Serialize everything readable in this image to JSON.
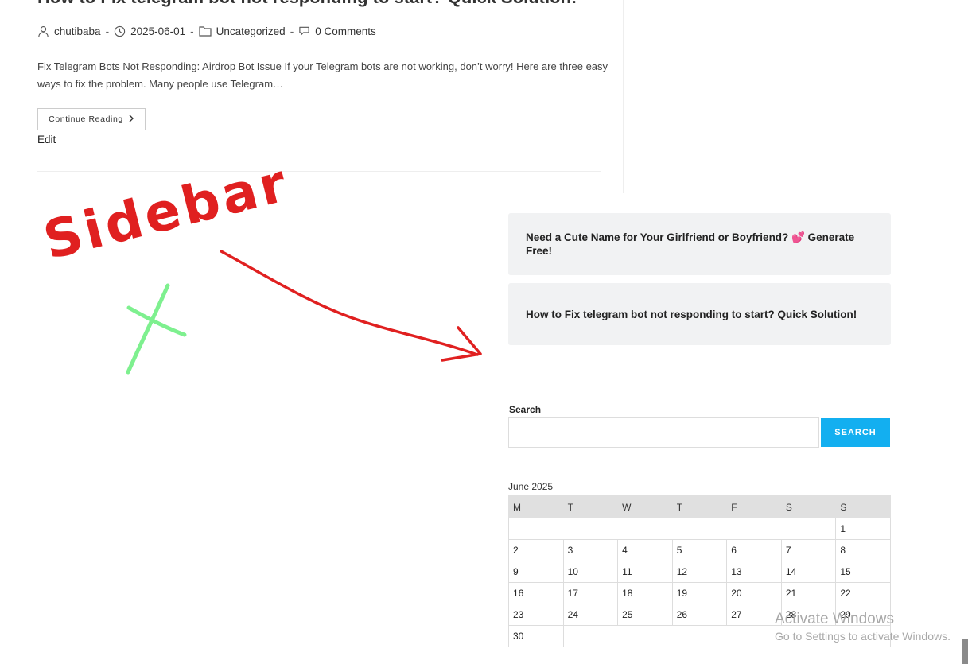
{
  "post": {
    "title": "How to Fix telegram bot not responding to start? Quick Solution!",
    "author": "chutibaba",
    "date": "2025-06-01",
    "category": "Uncategorized",
    "comments": "0 Comments",
    "separator": "-",
    "excerpt": "Fix Telegram Bots Not Responding: Airdrop Bot Issue If your Telegram bots are not working, don’t worry! Here are three easy ways to fix the problem. Many people use Telegram…",
    "continue_label": "Continue Reading",
    "edit_label": "Edit"
  },
  "annotation": {
    "handwritten_text": "Sidebar",
    "handwritten_color": "#e02020",
    "cross_color": "#7ef08f"
  },
  "sidebar": {
    "recent_posts": [
      {
        "title": "Need a Cute Name for Your Girlfriend or Boyfriend? 💕 Generate Free!"
      },
      {
        "title": "How to Fix telegram bot not responding to start? Quick Solution!"
      }
    ],
    "search": {
      "label": "Search",
      "value": "",
      "button_label": "SEARCH",
      "button_color": "#13aff0"
    },
    "calendar": {
      "caption": "June 2025",
      "weekdays": [
        "M",
        "T",
        "W",
        "T",
        "F",
        "S",
        "S"
      ],
      "weeks": [
        [
          "",
          "",
          "",
          "",
          "",
          "",
          "1"
        ],
        [
          "2",
          "3",
          "4",
          "5",
          "6",
          "7",
          "8"
        ],
        [
          "9",
          "10",
          "11",
          "12",
          "13",
          "14",
          "15"
        ],
        [
          "16",
          "17",
          "18",
          "19",
          "20",
          "21",
          "22"
        ],
        [
          "23",
          "24",
          "25",
          "26",
          "27",
          "28",
          "29"
        ],
        [
          "30"
        ]
      ]
    }
  },
  "watermark": {
    "line1": "Activate Windows",
    "line2": "Go to Settings to activate Windows."
  }
}
